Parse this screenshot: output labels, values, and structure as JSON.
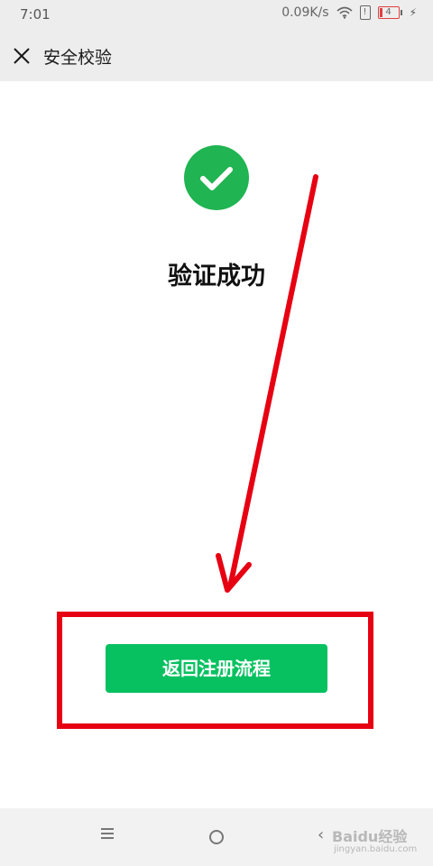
{
  "status_bar": {
    "time": "7:01",
    "network_speed": "0.09K/s",
    "wifi_icon": "wifi-icon",
    "sim_icon": "!",
    "battery_level": "4",
    "charging_icon": "⚡"
  },
  "nav": {
    "close_icon": "close-icon",
    "title": "安全校验"
  },
  "content": {
    "success_icon": "check-circle-icon",
    "success_color": "#20b452",
    "title": "验证成功"
  },
  "primary_button": {
    "label": "返回注册流程",
    "color": "#07c160"
  },
  "annotation": {
    "color": "#e60012"
  },
  "system_nav": {
    "menu_icon": "menu-icon",
    "home_icon": "home-icon",
    "back_icon": "back-icon"
  },
  "watermark": {
    "main": "Baidu经验",
    "sub": "jingyan.baidu.com"
  }
}
